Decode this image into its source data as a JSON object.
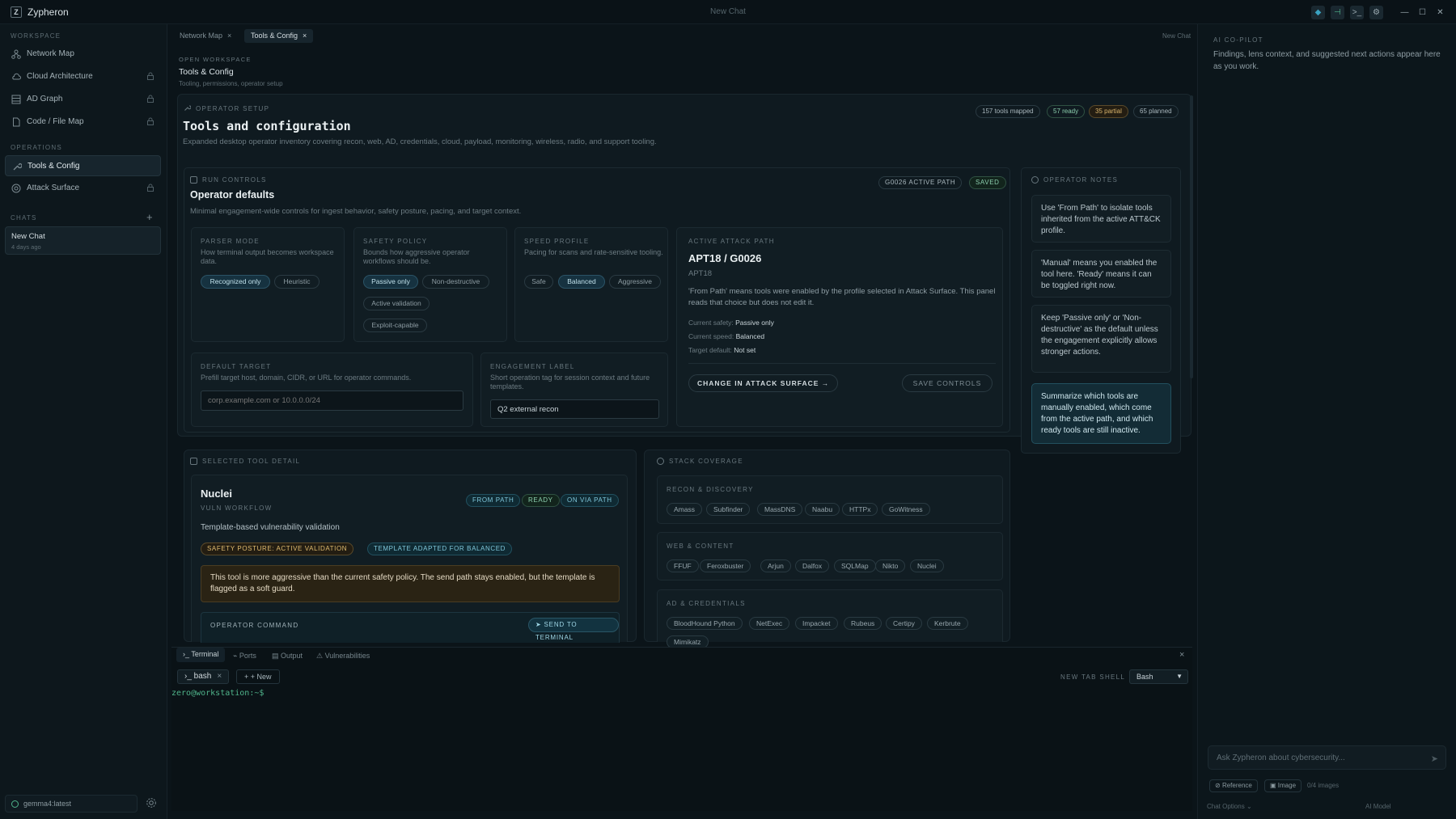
{
  "app": {
    "name": "Zypheron",
    "logo_letter": "Z",
    "window_title": "New Chat"
  },
  "window_controls": {
    "icons": [
      "shield-icon",
      "sidebar-icon",
      "terminal-icon",
      "settings-icon",
      "minimize-icon",
      "maximize-icon",
      "close-icon"
    ],
    "glyphs": [
      "◆",
      "⊣",
      ">_",
      "⚙",
      "—",
      "☐",
      "✕"
    ]
  },
  "sidebar": {
    "workspace_header": "WORKSPACE",
    "workspace_items": [
      {
        "label": "Network Map",
        "icon": "network-icon",
        "locked": false
      },
      {
        "label": "Cloud Architecture",
        "icon": "cloud-icon",
        "locked": true
      },
      {
        "label": "AD Graph",
        "icon": "graph-icon",
        "locked": true
      },
      {
        "label": "Code / File Map",
        "icon": "file-icon",
        "locked": true
      }
    ],
    "operations_header": "OPERATIONS",
    "operations_items": [
      {
        "label": "Tools & Config",
        "icon": "wrench-icon",
        "active": true
      },
      {
        "label": "Attack Surface",
        "icon": "target-icon",
        "locked": true
      }
    ],
    "chats_header": "CHATS",
    "chats": [
      {
        "title": "New Chat",
        "time": "4 days ago"
      }
    ],
    "model": "gemma4:latest"
  },
  "tabs": [
    {
      "label": "Network Map",
      "active": false
    },
    {
      "label": "Tools & Config",
      "active": true
    }
  ],
  "tabs_right": "New Chat",
  "workspace": {
    "header": "OPEN WORKSPACE",
    "title": "Tools & Config",
    "subtitle": "Tooling, permissions, operator setup"
  },
  "operator_setup": {
    "label": "OPERATOR SETUP",
    "title": "Tools and configuration",
    "description": "Expanded desktop operator inventory covering recon, web, AD, credentials, cloud, payload, monitoring, wireless, radio, and support tooling.",
    "stats": [
      "157 tools mapped",
      "57 ready",
      "35 partial",
      "65 planned"
    ]
  },
  "run_controls": {
    "label": "RUN CONTROLS",
    "title": "Operator defaults",
    "description": "Minimal engagement-wide controls for ingest behavior, safety posture, pacing, and target context.",
    "badges": [
      "G0026 ACTIVE PATH",
      "SAVED"
    ],
    "parser": {
      "label": "PARSER MODE",
      "desc": "How terminal output becomes workspace data.",
      "options": [
        "Recognized only",
        "Heuristic"
      ],
      "selected": 0
    },
    "safety": {
      "label": "SAFETY POLICY",
      "desc": "Bounds how aggressive operator workflows should be.",
      "options": [
        "Passive only",
        "Non-destructive",
        "Active validation",
        "Exploit-capable"
      ],
      "selected": 0
    },
    "speed": {
      "label": "SPEED PROFILE",
      "desc": "Pacing for scans and rate-sensitive tooling.",
      "options": [
        "Safe",
        "Balanced",
        "Aggressive"
      ],
      "selected": 1
    },
    "target": {
      "label": "DEFAULT TARGET",
      "desc": "Prefill target host, domain, CIDR, or URL for operator commands.",
      "placeholder": "corp.example.com or 10.0.0.0/24"
    },
    "engagement": {
      "label": "ENGAGEMENT LABEL",
      "desc": "Short operation tag for session context and future templates.",
      "value": "Q2 external recon"
    },
    "attack_path": {
      "label": "ACTIVE ATTACK PATH",
      "title": "APT18 / G0026",
      "subtitle": "APT18",
      "desc": "'From Path' means tools were enabled by the profile selected in Attack Surface. This panel reads that choice but does not edit it.",
      "safety_key": "Current safety:",
      "safety_val": "Passive only",
      "speed_key": "Current speed:",
      "speed_val": "Balanced",
      "target_key": "Target default:",
      "target_val": "Not set",
      "change_btn": "CHANGE IN ATTACK SURFACE",
      "save_btn": "SAVE CONTROLS"
    }
  },
  "operator_notes": {
    "label": "OPERATOR NOTES",
    "notes": [
      "Use 'From Path' to isolate tools inherited from the active ATT&CK profile.",
      "'Manual' means you enabled the tool here. 'Ready' means it can be toggled right now.",
      "Keep 'Passive only' or 'Non-destructive' as the default unless the engagement explicitly allows stronger actions.",
      "Summarize which tools are manually enabled, which come from the active path, and which ready tools are still inactive."
    ]
  },
  "tool_detail": {
    "label": "SELECTED TOOL DETAIL",
    "name": "Nuclei",
    "category": "VULN WORKFLOW",
    "badges": [
      "FROM PATH",
      "READY",
      "ON VIA PATH"
    ],
    "description": "Template-based vulnerability validation",
    "tags": [
      "SAFETY POSTURE: ACTIVE VALIDATION",
      "TEMPLATE ADAPTED FOR BALANCED"
    ],
    "warning": "This tool is more aggressive than the current safety policy. The send path stays enabled, but the template is flagged as a soft guard.",
    "command_label": "OPERATOR COMMAND",
    "send_btn": "SEND TO TERMINAL"
  },
  "stack": {
    "label": "STACK COVERAGE",
    "groups": [
      {
        "name": "RECON & DISCOVERY",
        "tools": [
          "Amass",
          "Subfinder",
          "MassDNS",
          "Naabu",
          "HTTPx",
          "GoWitness"
        ]
      },
      {
        "name": "WEB & CONTENT",
        "tools": [
          "FFUF",
          "Feroxbuster",
          "Arjun",
          "Dalfox",
          "SQLMap",
          "Nikto",
          "Nuclei"
        ]
      },
      {
        "name": "AD & CREDENTIALS",
        "tools": [
          "BloodHound Python",
          "NetExec",
          "Impacket",
          "Rubeus",
          "Certipy",
          "Kerbrute",
          "Mimikatz"
        ]
      }
    ]
  },
  "terminal": {
    "tabs": [
      "Terminal",
      "Ports",
      "Output",
      "Vulnerabilities"
    ],
    "session_tab": "bash",
    "new_btn": "+ New",
    "shell_label": "NEW TAB SHELL",
    "shell_value": "Bash",
    "prompt": "zero@workstation:~$"
  },
  "copilot": {
    "label": "AI CO-PILOT",
    "intro": "Findings, lens context, and suggested next actions appear here as you work.",
    "placeholder": "Ask Zypheron about cybersecurity...",
    "reference_btn": "Reference",
    "image_btn": "Image",
    "image_count": "0/4 images",
    "chat_options": "Chat Options",
    "model_label": "AI Model"
  },
  "colors": {
    "accent": "#3aa3c2",
    "warning": "#d9a441",
    "success": "#4fb38a"
  }
}
